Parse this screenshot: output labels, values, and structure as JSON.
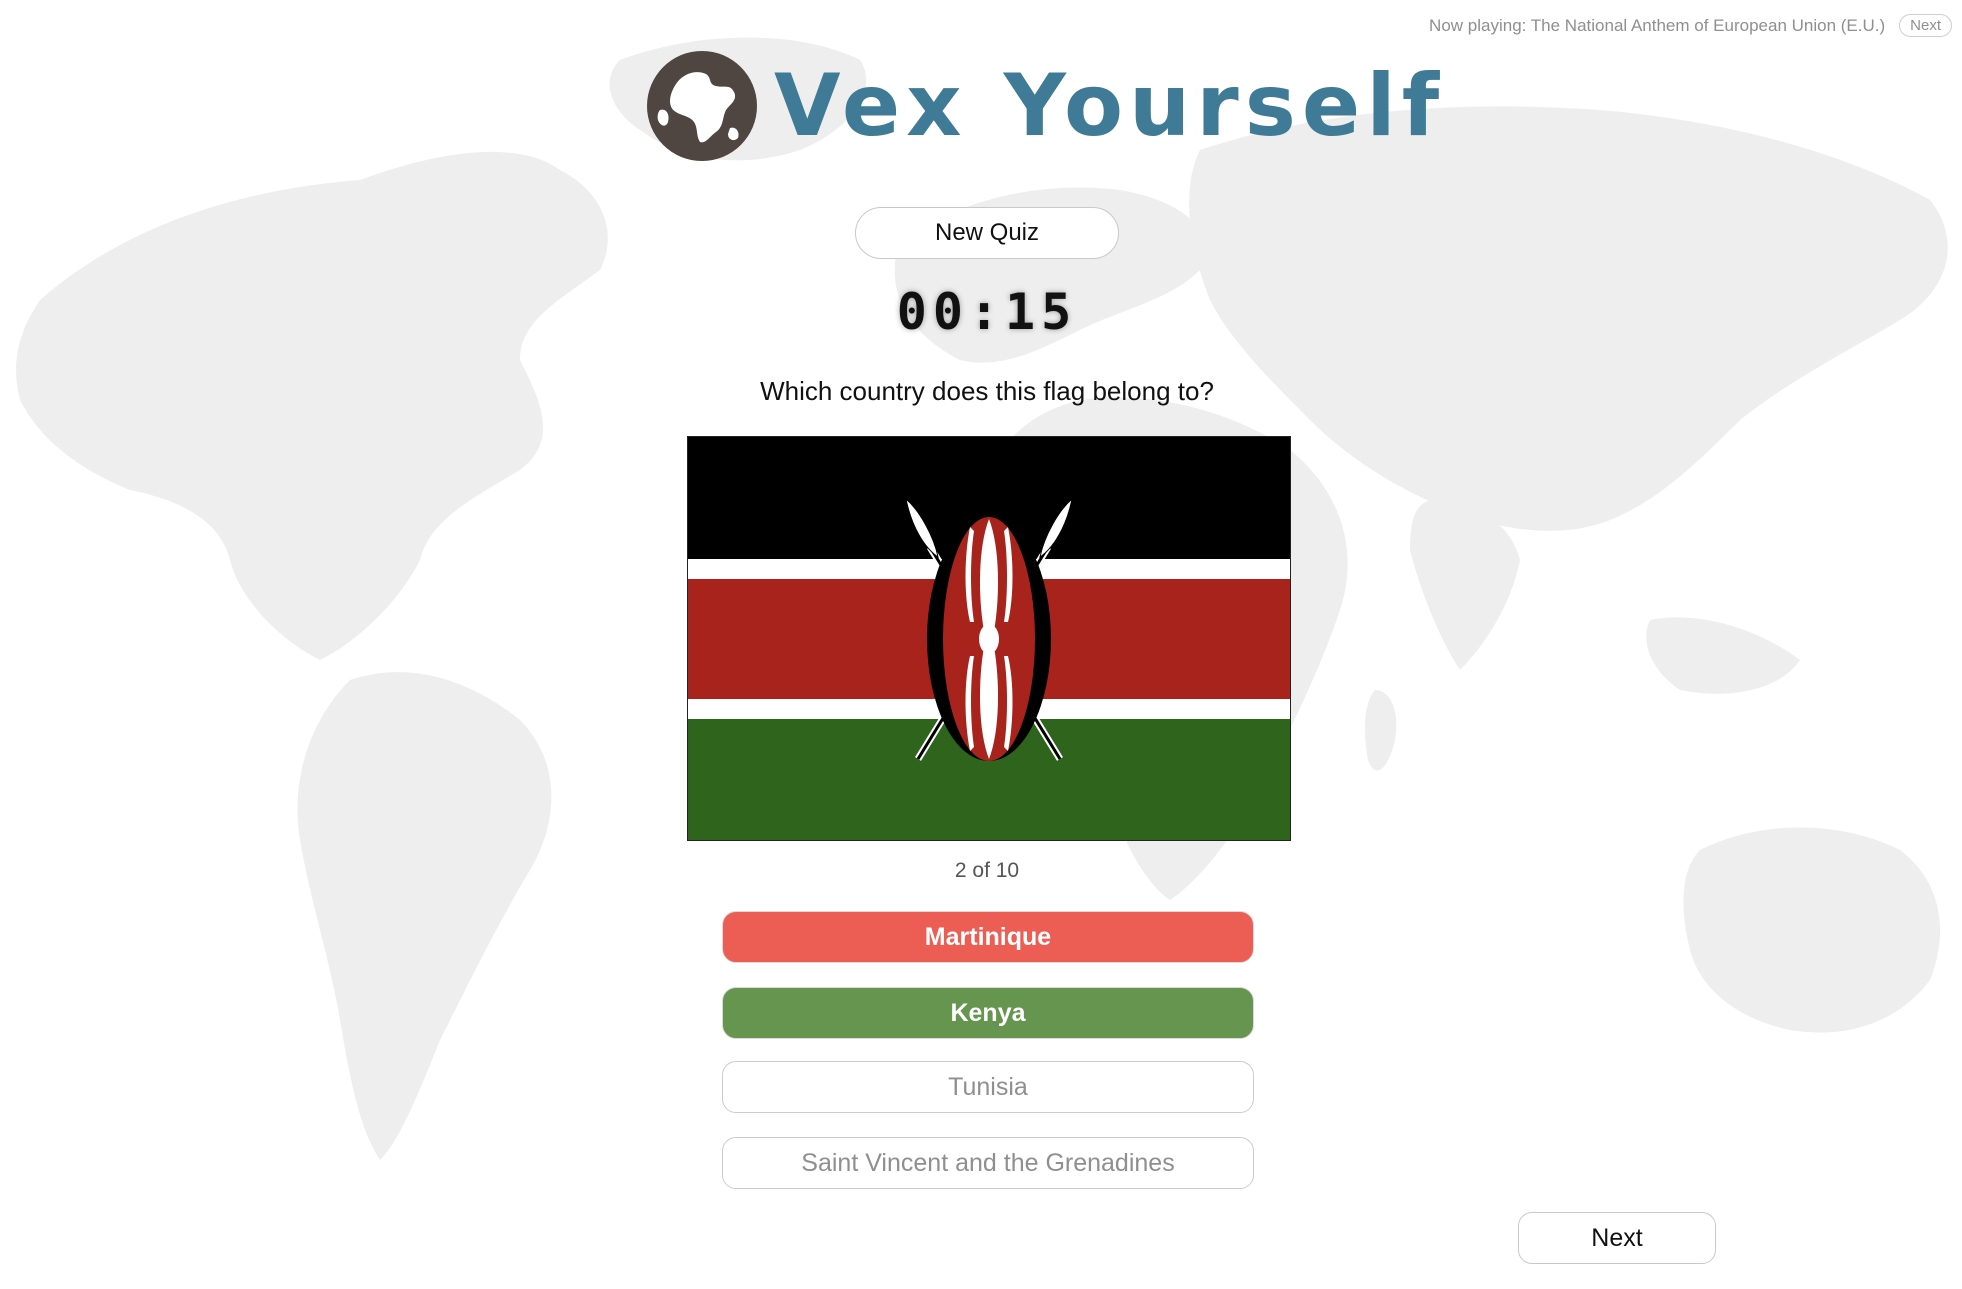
{
  "now_playing": {
    "text": "Now playing: The National Anthem of European Union (E.U.)",
    "next_label": "Next"
  },
  "logo": {
    "icon": "globe-icon",
    "text": "Vex Yourself",
    "text_color": "#3f7b97",
    "icon_color": "#4f4541"
  },
  "new_quiz_label": "New Quiz",
  "timer": "00:15",
  "question": "Which country does this flag belong to?",
  "flag": {
    "country": "Kenya",
    "colors": {
      "black": "#000000",
      "white": "#ffffff",
      "red": "#a8231b",
      "green": "#2e641b"
    }
  },
  "progress": "2 of 10",
  "answers": [
    {
      "label": "Martinique",
      "state": "wrong",
      "color": "#ec5d53"
    },
    {
      "label": "Kenya",
      "state": "correct",
      "color": "#65954f"
    },
    {
      "label": "Tunisia",
      "state": "unselected"
    },
    {
      "label": "Saint Vincent and the Grenadines",
      "state": "unselected"
    }
  ],
  "next_label": "Next"
}
